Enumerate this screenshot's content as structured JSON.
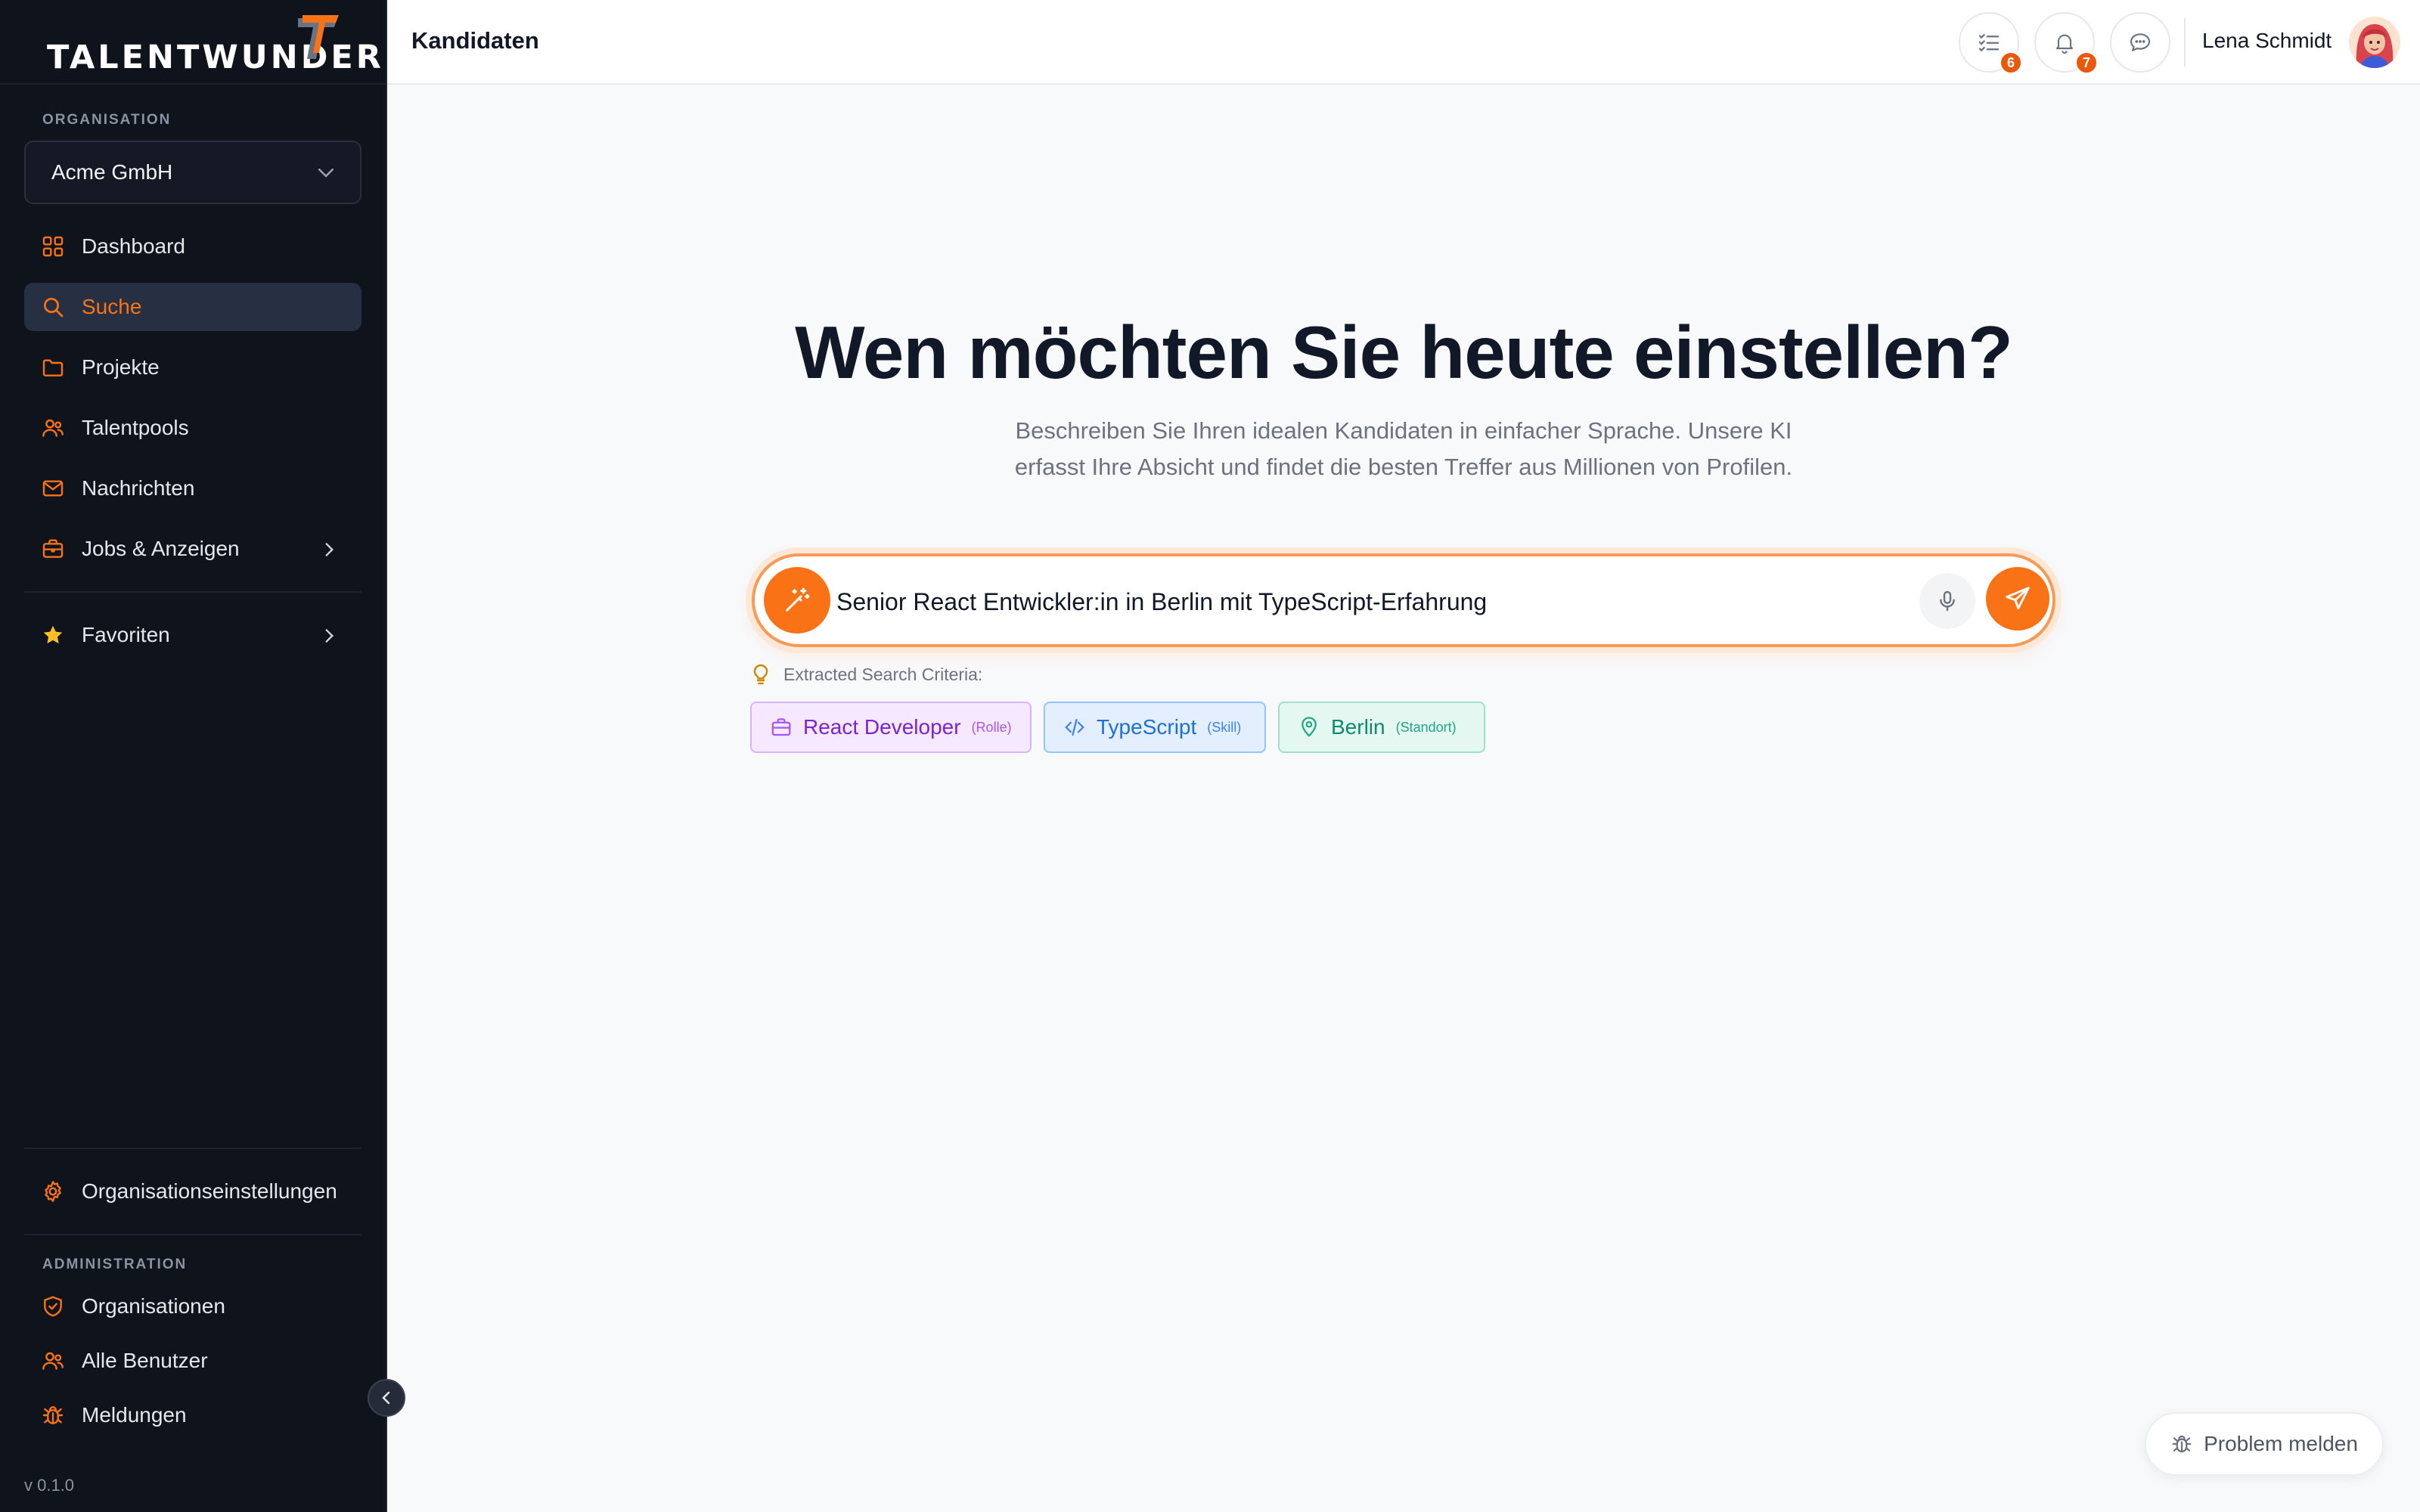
{
  "brand": {
    "name": "TALENTWUNDER",
    "accent": "#f97316"
  },
  "sidebar": {
    "org_label": "ORGANISATION",
    "org_selected": "Acme GmbH",
    "nav": [
      {
        "label": "Dashboard",
        "icon": "grid-icon"
      },
      {
        "label": "Suche",
        "icon": "search-icon",
        "active": true
      },
      {
        "label": "Projekte",
        "icon": "folder-icon"
      },
      {
        "label": "Talentpools",
        "icon": "users-icon"
      },
      {
        "label": "Nachrichten",
        "icon": "mail-icon"
      },
      {
        "label": "Jobs & Anzeigen",
        "icon": "briefcase-icon"
      }
    ],
    "favorites_label": "Favoriten",
    "settings_label": "Organisationseinstellungen",
    "admin_label": "ADMINISTRATION",
    "admin_items": [
      {
        "label": "Organisationen",
        "icon": "shield-icon"
      },
      {
        "label": "Alle Benutzer",
        "icon": "users-icon"
      },
      {
        "label": "Meldungen",
        "icon": "bug-icon"
      }
    ],
    "version": "v 0.1.0"
  },
  "header": {
    "title": "Kandidaten",
    "tasks_count": "6",
    "notifications_count": "7",
    "user_name": "Lena Schmidt"
  },
  "hero": {
    "title": "Wen möchten Sie heute einstellen?",
    "subtitle": "Beschreiben Sie Ihren idealen Kandidaten in einfacher Sprache. Unsere KI erfasst Ihre Absicht und findet die besten Treffer aus Millionen von Profilen."
  },
  "search": {
    "value": "Senior React Entwickler:in in Berlin mit TypeScript-Erfahrung"
  },
  "criteria": {
    "label": "Extracted Search Criteria:",
    "chips": [
      {
        "value": "React Developer",
        "type": "(Rolle)",
        "icon": "briefcase-icon"
      },
      {
        "value": "TypeScript",
        "type": "(Skill)",
        "icon": "code-icon"
      },
      {
        "value": "Berlin",
        "type": "(Standort)",
        "icon": "map-pin-icon"
      }
    ]
  },
  "report": {
    "label": "Problem melden"
  }
}
